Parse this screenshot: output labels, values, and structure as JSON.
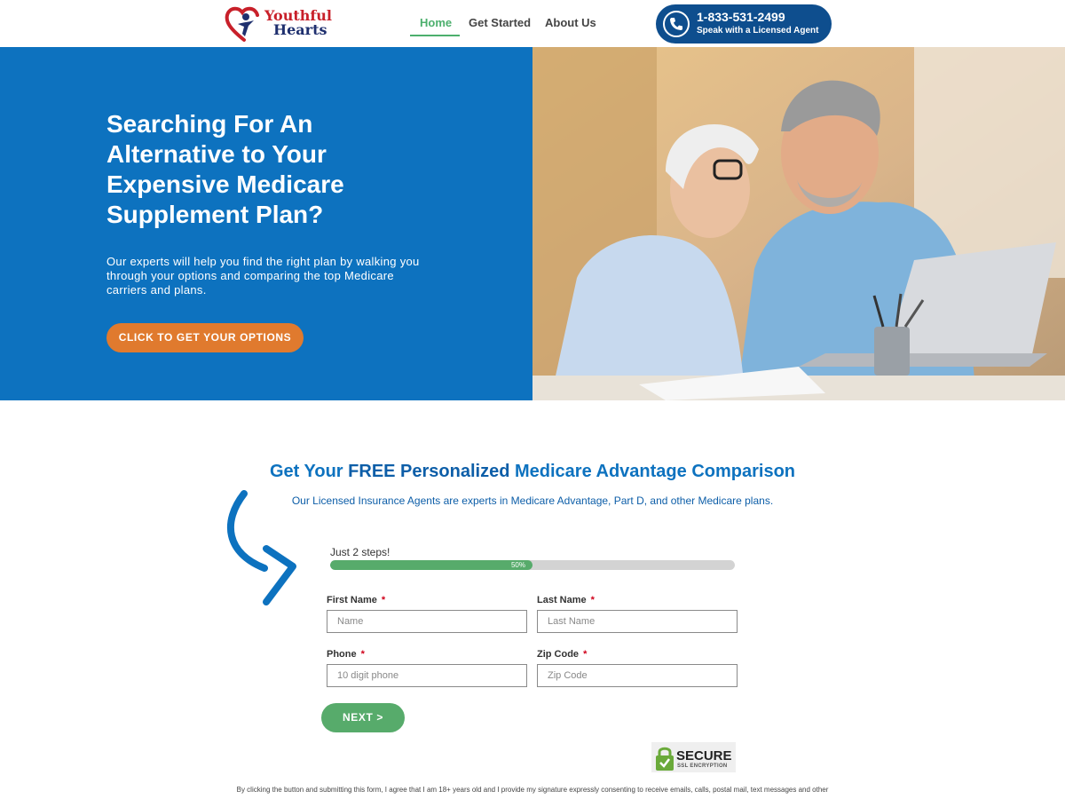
{
  "header": {
    "logo": {
      "line1": "Youthful",
      "line2": "Hearts"
    },
    "nav": [
      {
        "label": "Home",
        "active": true
      },
      {
        "label": "Get Started",
        "active": false
      },
      {
        "label": "About Us",
        "active": false
      }
    ],
    "phone": {
      "number": "1-833-531-2499",
      "subtitle": "Speak with a Licensed Agent",
      "icon": "phone-icon"
    }
  },
  "hero": {
    "title": "Searching For An Alternative to Your Expensive Medicare Supplement Plan?",
    "text": "Our experts will help you find the right plan by walking you through your options and comparing the top Medicare carriers and plans.",
    "cta_label": "CLICK TO GET YOUR OPTIONS",
    "image": "couple-at-laptop-photo"
  },
  "comparison": {
    "title_pre": "Get Your",
    "title_bold": "FREE Personalized",
    "title_post": "Medicare Advantage Comparison",
    "subtitle": "Our Licensed Insurance Agents are experts in Medicare Advantage, Part D, and other Medicare plans."
  },
  "form": {
    "steps_label": "Just 2 steps!",
    "progress": {
      "percent": 50,
      "label": "50%"
    },
    "fields": {
      "first_name": {
        "label": "First Name",
        "required_mark": "*",
        "placeholder": "Name",
        "value": ""
      },
      "last_name": {
        "label": "Last Name",
        "required_mark": "*",
        "placeholder": "Last Name",
        "value": ""
      },
      "phone": {
        "label": "Phone",
        "required_mark": "*",
        "placeholder": "10 digit phone",
        "value": ""
      },
      "zip": {
        "label": "Zip Code",
        "required_mark": "*",
        "placeholder": "Zip Code",
        "value": ""
      }
    },
    "next_label": "NEXT >"
  },
  "secure_badge": {
    "word": "SECURE",
    "sub": "SSL ENCRYPTION",
    "icon": "padlock-check-icon"
  },
  "consent": "By clicking the button and submitting this form, I agree that I am 18+ years old and I provide my signature expressly consenting to receive emails, calls, postal mail, text messages and other",
  "colors": {
    "hero_blue": "#0d72bf",
    "accent_orange": "#e07a2e",
    "accent_green": "#57ab6b",
    "phone_navy": "#0e4e8e",
    "logo_red": "#c8202a"
  }
}
